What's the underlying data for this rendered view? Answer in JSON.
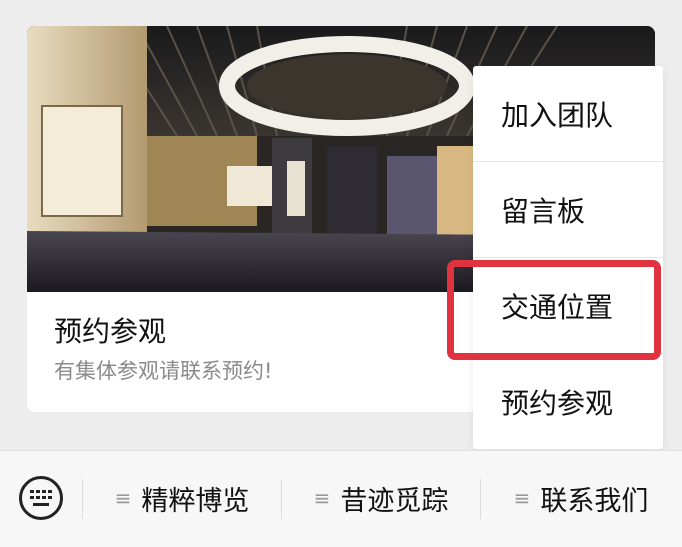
{
  "card": {
    "title": "预约参观",
    "description": "有集体参观请联系预约!"
  },
  "popup_menu": {
    "items": [
      {
        "label": "加入团队"
      },
      {
        "label": "留言板"
      },
      {
        "label": "交通位置",
        "highlighted": true
      },
      {
        "label": "预约参观"
      }
    ],
    "highlight_color": "#e0323f"
  },
  "bottom_bar": {
    "keyboard_icon": "keyboard-icon",
    "menu_glyph": "≡",
    "items": [
      {
        "label": "精粹博览"
      },
      {
        "label": "昔迹觅踪"
      },
      {
        "label": "联系我们"
      }
    ]
  }
}
